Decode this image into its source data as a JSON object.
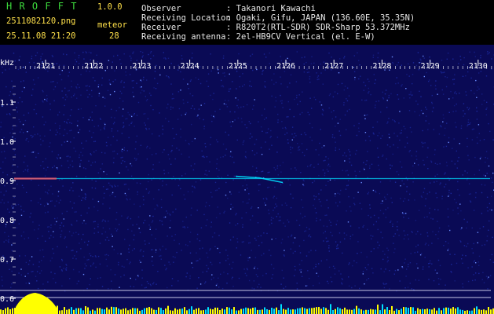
{
  "app": {
    "title": "H R O F F T",
    "version": "1.0.0",
    "filename": "2511082120.png",
    "datetime": "25.11.08 21:20",
    "meteor_label": "meteor",
    "meteor_count": "28"
  },
  "info": {
    "observer_label": "Observer",
    "observer_value": ": Takanori Kawachi",
    "location_label": "Receiving Location",
    "location_value": ": Ogaki, Gifu, JAPAN (136.60E, 35.35N)",
    "receiver_label": "Receiver",
    "receiver_value": ": R820T2(RTL-SDR) SDR-Sharp 53.372MHz",
    "antenna_label": "Receiving antenna",
    "antenna_value": ": 2el-HB9CV Vertical (el. E-W)"
  },
  "spectrogram": {
    "y_unit": "kHz",
    "y_ticks": [
      "1.1",
      "1.0",
      "0.9",
      "0.8",
      "0.7",
      "0.6"
    ],
    "y_values": [
      1.1,
      1.0,
      0.9,
      0.8,
      0.7,
      0.6
    ],
    "y_range": [
      0.588,
      1.17
    ],
    "x_ticks": [
      "2121",
      "2122",
      "2123",
      "2124",
      "2125",
      "2126",
      "2127",
      "2128",
      "2129",
      "2130"
    ],
    "x_values": [
      2121,
      2122,
      2123,
      2124,
      2125,
      2126,
      2127,
      2128,
      2129,
      2130
    ],
    "x_range": [
      2120.5,
      2130.15
    ],
    "carrier_khz": 0.905,
    "colors": {
      "background": "#0a0a55",
      "noise_low": "#1c2aa0",
      "noise_high": "#6a8cff",
      "signal": "#00e0ff",
      "tick_text": "#ffffff",
      "level_line": "#c8c8e6",
      "level_fill": "#ffff00",
      "level_base": "#00e0ff"
    }
  }
}
